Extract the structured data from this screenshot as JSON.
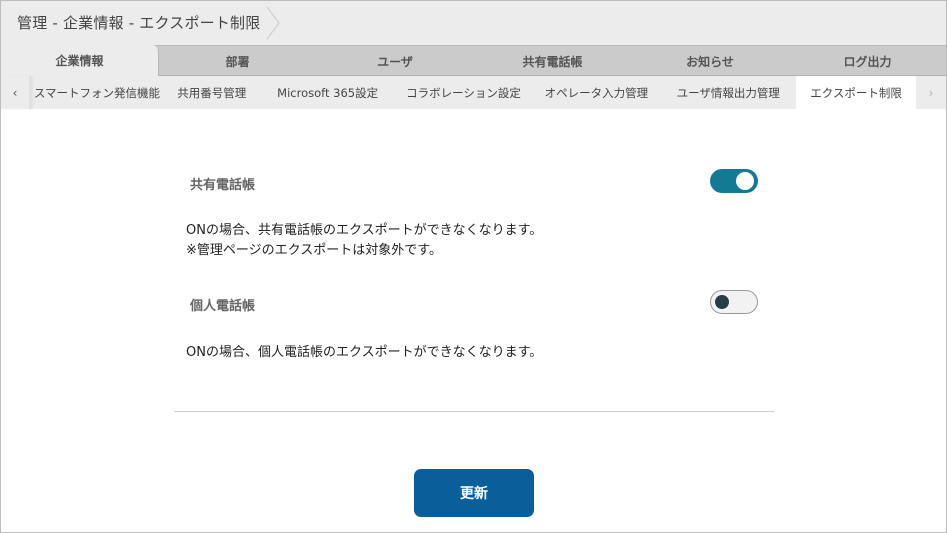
{
  "header": {
    "breadcrumb": "管理 - 企業情報 - エクスポート制限"
  },
  "main_tabs": [
    {
      "label": "企業情報",
      "active": true
    },
    {
      "label": "部署",
      "active": false
    },
    {
      "label": "ユーザ",
      "active": false
    },
    {
      "label": "共有電話帳",
      "active": false
    },
    {
      "label": "お知らせ",
      "active": false
    },
    {
      "label": "ログ出力",
      "active": false
    }
  ],
  "sub_tabs": {
    "prev_icon": "‹",
    "next_icon": "›",
    "items": [
      {
        "label": "スマートフォン発信機能",
        "active": false
      },
      {
        "label": "共用番号管理",
        "active": false
      },
      {
        "label": "Microsoft 365設定",
        "active": false
      },
      {
        "label": "コラボレーション設定",
        "active": false
      },
      {
        "label": "オペレータ入力管理",
        "active": false
      },
      {
        "label": "ユーザ情報出力管理",
        "active": false
      },
      {
        "label": "エクスポート制限",
        "active": true
      }
    ]
  },
  "settings": [
    {
      "label": "共有電話帳",
      "enabled": true,
      "description": [
        "ONの場合、共有電話帳のエクスポートができなくなります。",
        "※管理ページのエクスポートは対象外です。"
      ]
    },
    {
      "label": "個人電話帳",
      "enabled": false,
      "description": [
        "ONの場合、個人電話帳のエクスポートができなくなります。"
      ]
    }
  ],
  "actions": {
    "update_label": "更新"
  },
  "colors": {
    "toggle_on": "#137a94",
    "button_primary": "#0a5f9a"
  }
}
